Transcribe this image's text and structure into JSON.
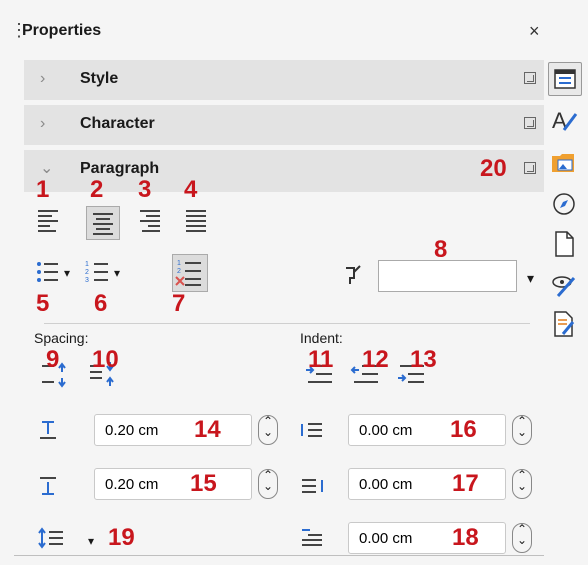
{
  "panel": {
    "title": "Properties",
    "close_symbol": "×",
    "menu_symbol": "≡"
  },
  "sections": {
    "style": "Style",
    "character": "Character",
    "paragraph": "Paragraph"
  },
  "paragraph": {
    "spacing_label": "Spacing:",
    "indent_label": "Indent:",
    "above_spacing": "0.20 cm",
    "below_spacing": "0.20 cm",
    "before_indent": "0.00 cm",
    "after_indent": "0.00 cm",
    "first_line_indent": "0.00 cm"
  },
  "annotations": [
    "1",
    "2",
    "3",
    "4",
    "5",
    "6",
    "7",
    "8",
    "9",
    "10",
    "11",
    "12",
    "13",
    "14",
    "15",
    "16",
    "17",
    "18",
    "19",
    "20"
  ],
  "icons": {
    "deck": [
      "properties-icon",
      "styles-icon",
      "gallery-icon",
      "navigator-icon",
      "page-icon",
      "style-inspector-icon",
      "manage-changes-icon"
    ]
  },
  "colors": {
    "annotation": "#c8161d",
    "section_bg": "#e3e3e3",
    "bullet_blue": "#2b6cd0",
    "clear_red": "#d9534f"
  }
}
